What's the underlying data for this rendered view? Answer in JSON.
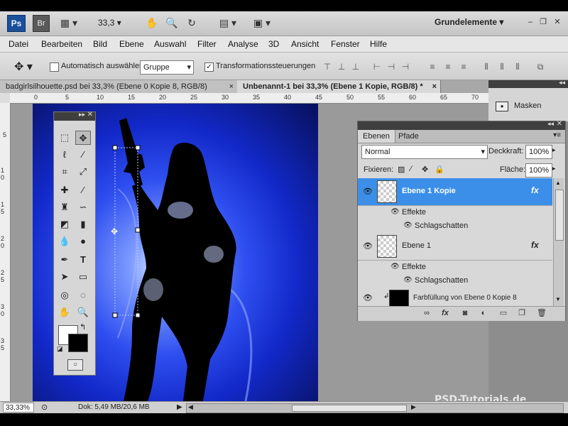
{
  "app": {
    "logo": "Ps",
    "bridge": "Br",
    "zoom": "33,3",
    "workspace": "Grundelemente"
  },
  "menu": [
    "Datei",
    "Bearbeiten",
    "Bild",
    "Ebene",
    "Auswahl",
    "Filter",
    "Analyse",
    "3D",
    "Ansicht",
    "Fenster",
    "Hilfe"
  ],
  "options": {
    "auto_select_label": "Automatisch auswählen:",
    "auto_select_value": "Gruppe",
    "transform_label": "Transformationssteuerungen"
  },
  "tabs": [
    {
      "label": "badgirlsilhouette.psd bei 33,3% (Ebene 0 Kopie 8, RGB/8)",
      "close": "×"
    },
    {
      "label": "Unbenannt-1 bei 33,3% (Ebene 1 Kopie, RGB/8) *",
      "close": "×"
    }
  ],
  "hruler_ticks": [
    "0",
    "5",
    "10",
    "15",
    "20",
    "25",
    "30",
    "35",
    "40",
    "45",
    "50",
    "55",
    "60",
    "65",
    "70"
  ],
  "vruler_ticks": [
    "5",
    "1 0",
    "1 5",
    "2 0",
    "2 5",
    "3 0",
    "3 5"
  ],
  "masks_panel": {
    "label": "Masken"
  },
  "layers_panel": {
    "tabs": [
      "Ebenen",
      "Pfade"
    ],
    "blend_mode": "Normal",
    "opacity_label": "Deckkraft:",
    "opacity_value": "100%",
    "lock_label": "Fixieren:",
    "fill_label": "Fläche:",
    "fill_value": "100%",
    "layers": [
      {
        "name": "Ebene 1 Kopie",
        "effects_label": "Effekte",
        "effect": "Schlagschatten",
        "selected": true
      },
      {
        "name": "Ebene 1",
        "effects_label": "Effekte",
        "effect": "Schlagschatten",
        "selected": false
      },
      {
        "name": "Farbfüllung von Ebene 0 Kopie 8",
        "selected": false
      }
    ],
    "fx": "fx"
  },
  "status": {
    "zoom": "33,33%",
    "doc_size": "Dok: 5,49 MB/20,6 MB"
  },
  "watermark": "PSD-Tutorials.de",
  "colors": {
    "selected_layer": "#3b8fe8",
    "canvas_blue": "#1228c8"
  }
}
